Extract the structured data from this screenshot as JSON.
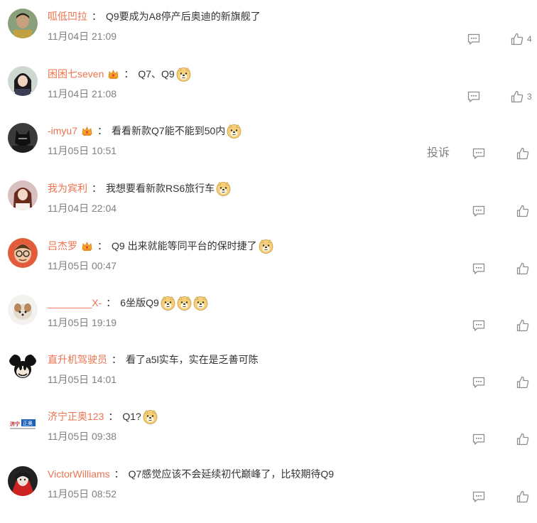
{
  "comments": [
    {
      "user": "呱低凹拉",
      "vip": false,
      "text": "Q9要成为A8停产后奥迪的新旗舰了",
      "emojis": 0,
      "time": "11月04日 21:09",
      "likes": "4",
      "report": ""
    },
    {
      "user": "困困七seven",
      "vip": true,
      "text": "Q7、Q9",
      "emojis": 1,
      "time": "11月04日 21:08",
      "likes": "3",
      "report": ""
    },
    {
      "user": "-imyu7",
      "vip": true,
      "text": "看看新款Q7能不能到50内",
      "emojis": 1,
      "time": "11月05日 10:51",
      "likes": "",
      "report": "投诉"
    },
    {
      "user": "我为宾利",
      "vip": false,
      "text": "我想要看新款RS6旅行车",
      "emojis": 1,
      "time": "11月04日 22:04",
      "likes": "",
      "report": ""
    },
    {
      "user": "吕杰罗",
      "vip": true,
      "text": "Q9 出来就能等同平台的保时捷了",
      "emojis": 1,
      "time": "11月05日 00:47",
      "likes": "",
      "report": ""
    },
    {
      "user": "________X-",
      "vip": false,
      "text": "6坐版Q9",
      "emojis": 3,
      "time": "11月05日 19:19",
      "likes": "",
      "report": ""
    },
    {
      "user": "直升机驾驶员",
      "vip": false,
      "text": "看了a5l实车，实在是乏善可陈",
      "emojis": 0,
      "time": "11月05日 14:01",
      "likes": "",
      "report": ""
    },
    {
      "user": "济宁正奥123",
      "vip": false,
      "text": "Q1?",
      "emojis": 1,
      "time": "11月05日 09:38",
      "likes": "",
      "report": ""
    },
    {
      "user": "VictorWilliams",
      "vip": false,
      "text": "Q7感觉应该不会延续初代巅峰了，比较期待Q9",
      "emojis": 0,
      "time": "11月05日 08:52",
      "likes": "",
      "report": ""
    }
  ],
  "separator": "：",
  "icons": {
    "reply": "comment-icon",
    "like": "thumbs-up-icon",
    "vip": "vip-crown-icon",
    "emoji": "doge-emoji-icon"
  },
  "colors": {
    "username": "#eb7350",
    "text": "#333333",
    "meta": "#808080"
  }
}
